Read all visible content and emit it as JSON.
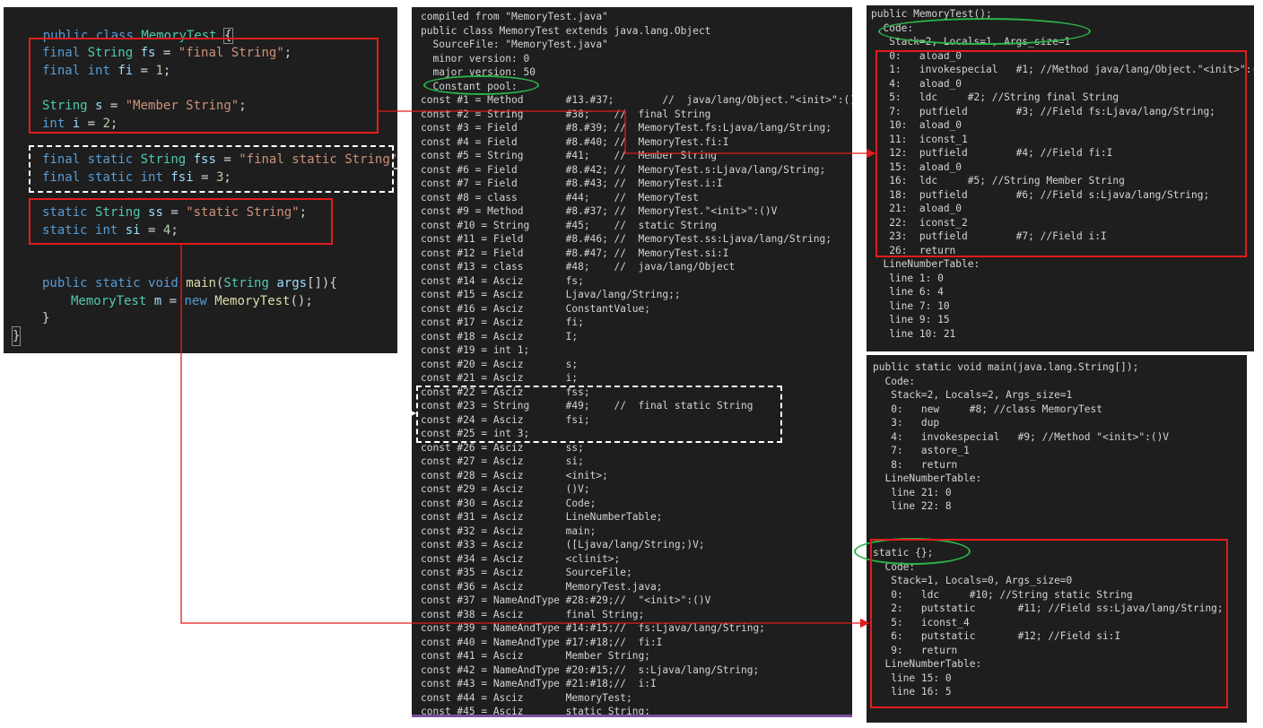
{
  "source": {
    "class_decl": "public class MemoryTest {",
    "lines": {
      "fs": "final String fs = \"final String\";",
      "fi": "final int fi = 1;",
      "s": "String s = \"Member String\";",
      "i": "int i = 2;",
      "fss": "final static String fss = \"final static String\";",
      "fsi": "final static int fsi = 3;",
      "ss": "static String ss = \"static String\";",
      "si": "static int si = 4;",
      "main": "public static void main(String args[]){",
      "new": "MemoryTest m = new MemoryTest();",
      "close_inner": "}",
      "close_outer": "}"
    }
  },
  "constant_pool": {
    "header": [
      "compiled from \"MemoryTest.java\"",
      "public class MemoryTest extends java.lang.Object",
      "  SourceFile: \"MemoryTest.java\"",
      "  minor version: 0",
      "  major version: 50",
      "  Constant pool:"
    ],
    "entries": [
      "const #1 = Method       #13.#37;        //  java/lang/Object.\"<init>\":()V",
      "const #2 = String       #38;    //  final String",
      "const #3 = Field        #8.#39; //  MemoryTest.fs:Ljava/lang/String;",
      "const #4 = Field        #8.#40; //  MemoryTest.fi:I",
      "const #5 = String       #41;    //  Member String",
      "const #6 = Field        #8.#42; //  MemoryTest.s:Ljava/lang/String;",
      "const #7 = Field        #8.#43; //  MemoryTest.i:I",
      "const #8 = class        #44;    //  MemoryTest",
      "const #9 = Method       #8.#37; //  MemoryTest.\"<init>\":()V",
      "const #10 = String      #45;    //  static String",
      "const #11 = Field       #8.#46; //  MemoryTest.ss:Ljava/lang/String;",
      "const #12 = Field       #8.#47; //  MemoryTest.si:I",
      "const #13 = class       #48;    //  java/lang/Object",
      "const #14 = Asciz       fs;",
      "const #15 = Asciz       Ljava/lang/String;;",
      "const #16 = Asciz       ConstantValue;",
      "const #17 = Asciz       fi;",
      "const #18 = Asciz       I;",
      "const #19 = int 1;",
      "const #20 = Asciz       s;",
      "const #21 = Asciz       i;",
      "const #22 = Asciz       fss;",
      "const #23 = String      #49;    //  final static String",
      "const #24 = Asciz       fsi;",
      "const #25 = int 3;",
      "const #26 = Asciz       ss;",
      "const #27 = Asciz       si;",
      "const #28 = Asciz       <init>;",
      "const #29 = Asciz       ()V;",
      "const #30 = Asciz       Code;",
      "const #31 = Asciz       LineNumberTable;",
      "const #32 = Asciz       main;",
      "const #33 = Asciz       ([Ljava/lang/String;)V;",
      "const #34 = Asciz       <clinit>;",
      "const #35 = Asciz       SourceFile;",
      "const #36 = Asciz       MemoryTest.java;",
      "const #37 = NameAndType #28:#29;//  \"<init>\":()V",
      "const #38 = Asciz       final String;",
      "const #39 = NameAndType #14:#15;//  fs:Ljava/lang/String;",
      "const #40 = NameAndType #17:#18;//  fi:I",
      "const #41 = Asciz       Member String;",
      "const #42 = NameAndType #20:#15;//  s:Ljava/lang/String;",
      "const #43 = NameAndType #21:#18;//  i:I",
      "const #44 = Asciz       MemoryTest;",
      "const #45 = Asciz       static String;"
    ]
  },
  "constructor": {
    "lines": [
      "public MemoryTest();",
      "  Code:",
      "   Stack=2, Locals=1, Args_size=1",
      "   0:   aload_0",
      "   1:   invokespecial   #1; //Method java/lang/Object.\"<init>\":()V",
      "   4:   aload_0",
      "   5:   ldc     #2; //String final String",
      "   7:   putfield        #3; //Field fs:Ljava/lang/String;",
      "   10:  aload_0",
      "   11:  iconst_1",
      "   12:  putfield        #4; //Field fi:I",
      "   15:  aload_0",
      "   16:  ldc     #5; //String Member String",
      "   18:  putfield        #6; //Field s:Ljava/lang/String;",
      "   21:  aload_0",
      "   22:  iconst_2",
      "   23:  putfield        #7; //Field i:I",
      "   26:  return",
      "  LineNumberTable:",
      "   line 1: 0",
      "   line 6: 4",
      "   line 7: 10",
      "   line 9: 15",
      "   line 10: 21"
    ]
  },
  "main_method": {
    "lines": [
      "public static void main(java.lang.String[]);",
      "  Code:",
      "   Stack=2, Locals=2, Args_size=1",
      "   0:   new     #8; //class MemoryTest",
      "   3:   dup",
      "   4:   invokespecial   #9; //Method \"<init>\":()V",
      "   7:   astore_1",
      "   8:   return",
      "  LineNumberTable:",
      "   line 21: 0",
      "   line 22: 8"
    ]
  },
  "static_block": {
    "lines": [
      "static {};",
      "  Code:",
      "   Stack=1, Locals=0, Args_size=0",
      "   0:   ldc     #10; //String static String",
      "   2:   putstatic       #11; //Field ss:Ljava/lang/String;",
      "   5:   iconst_4",
      "   6:   putstatic       #12; //Field si:I",
      "   9:   return",
      "  LineNumberTable:",
      "   line 15: 0",
      "   line 16: 5"
    ]
  },
  "colors": {
    "panel_bg": "#1e1e1e",
    "highlight_box": "#e31b1b",
    "oval": "#2bb34a",
    "dashed_box": "#ffffff",
    "keyword": "#569cd6",
    "type": "#4ec9b0",
    "string": "#ce9178",
    "number": "#b5cea8"
  }
}
